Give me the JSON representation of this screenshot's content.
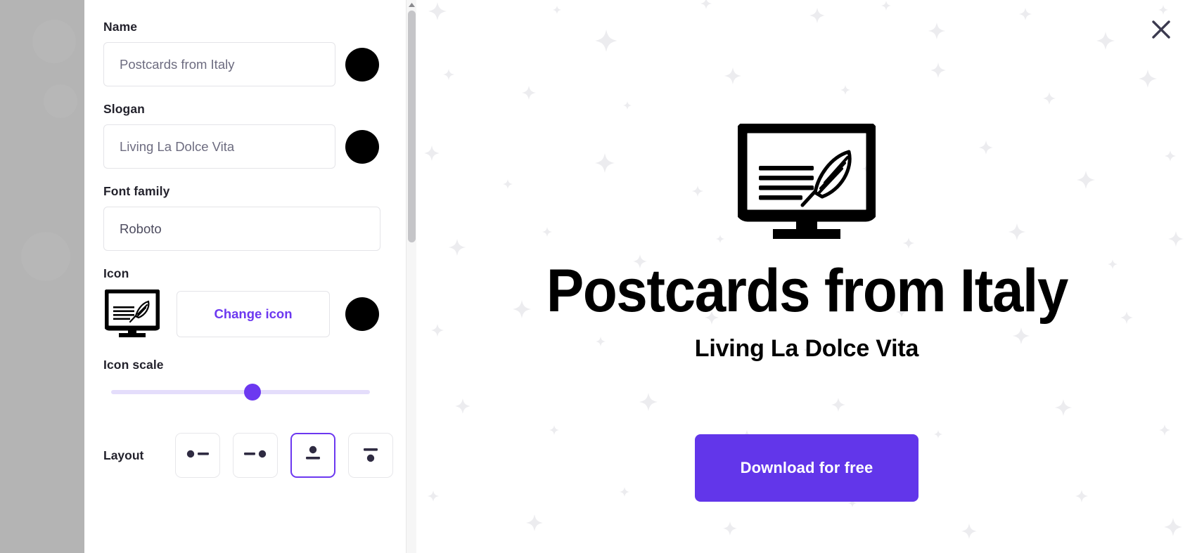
{
  "form": {
    "name": {
      "label": "Name",
      "value": "Postcards from Italy",
      "placeholder": "Postcards from Italy",
      "color": "#000000"
    },
    "slogan": {
      "label": "Slogan",
      "value": "Living La Dolce Vita",
      "placeholder": "Living La Dolce Vita",
      "color": "#000000"
    },
    "font_family": {
      "label": "Font family",
      "value": "Roboto"
    },
    "icon": {
      "label": "Icon",
      "icon_name": "monitor-with-quill-icon",
      "change_label": "Change icon",
      "color": "#000000"
    },
    "icon_scale": {
      "label": "Icon scale",
      "value": 55
    },
    "layout": {
      "label": "Layout",
      "selected_index": 2,
      "options": [
        {
          "name": "icon-left-text-right",
          "icon": "dot-left-line-right-icon"
        },
        {
          "name": "text-left-icon-right",
          "icon": "line-left-dot-right-icon"
        },
        {
          "name": "icon-top-text-bottom",
          "icon": "dot-above-line-below-icon"
        },
        {
          "name": "text-top-icon-bottom",
          "icon": "line-above-dot-below-icon"
        }
      ]
    }
  },
  "preview": {
    "title": "Postcards from Italy",
    "slogan": "Living La Dolce Vita",
    "icon_name": "monitor-with-quill-icon",
    "download_label": "Download for free"
  },
  "close": {
    "icon": "close-icon"
  },
  "colors": {
    "accent": "#6c38f0",
    "download_button": "#6236ea",
    "slider_track": "#e4ddfb",
    "sparkle": "#ececef",
    "backdrop": "#b4b4b4",
    "text_dark": "#23222c",
    "input_text": "#6d6c80"
  }
}
